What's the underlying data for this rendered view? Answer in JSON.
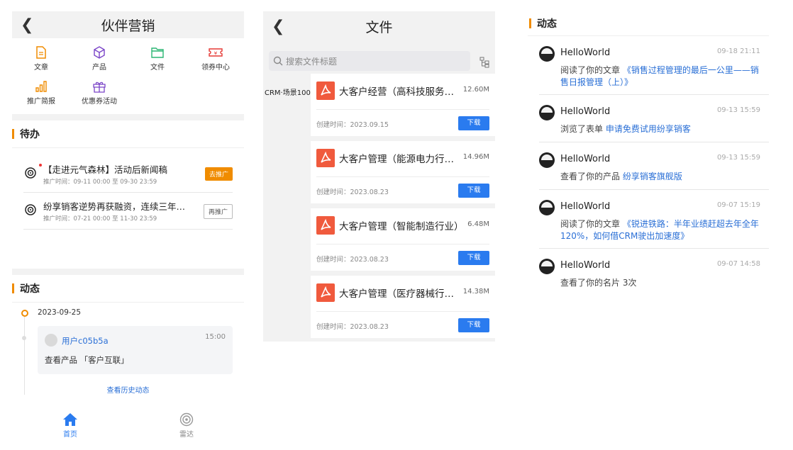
{
  "colors": {
    "accent": "#f08c00",
    "link": "#2a6fd6",
    "primary_button": "#2a7bef",
    "pdf": "#f05a3d"
  },
  "panel1": {
    "title": "伙伴营销",
    "grid": [
      {
        "label": "文章",
        "icon": "document-icon",
        "color": "#f08c00"
      },
      {
        "label": "产品",
        "icon": "cube-icon",
        "color": "#7a44c8"
      },
      {
        "label": "文件",
        "icon": "folder-icon",
        "color": "#2bb673"
      },
      {
        "label": "领券中心",
        "icon": "coupon-icon",
        "color": "#e53935"
      },
      {
        "label": "推广简报",
        "icon": "bar-chart-icon",
        "color": "#f08c00"
      },
      {
        "label": "优惠券活动",
        "icon": "gift-icon",
        "color": "#7a44c8"
      }
    ],
    "todo_title": "待办",
    "todos": [
      {
        "title": "【走进元气森林】活动后新闻稿",
        "time": "推广时间：09-11 00:00 至 09-30 23:59",
        "button": "去推广"
      },
      {
        "title": "纷享销客逆势再获融资，连续三年…",
        "time": "推广时间：07-21 00:00 至 11-30 23:59",
        "button": "再推广"
      }
    ],
    "dyn_title": "动态",
    "timeline_date": "2023-09-25",
    "card_user": "用户c05b5a",
    "card_time": "15:00",
    "card_action": "查看产品 「客户互联」",
    "history_link": "查看历史动态",
    "tabs": [
      {
        "label": "首页",
        "icon": "home-icon"
      },
      {
        "label": "雷达",
        "icon": "radar-icon"
      }
    ]
  },
  "panel2": {
    "title": "文件",
    "search_placeholder": "搜索文件标题",
    "category": "CRM·场景100",
    "files": [
      {
        "name": "大客户经营（高科技服务…",
        "size": "12.60M",
        "created": "创建时间：2023.09.15",
        "download": "下载"
      },
      {
        "name": "大客户管理（能源电力行…",
        "size": "14.96M",
        "created": "创建时间：2023.08.23",
        "download": "下载"
      },
      {
        "name": "大客户管理（智能制造行业）",
        "size": "6.48M",
        "created": "创建时间：2023.08.23",
        "download": "下载"
      },
      {
        "name": "大客户管理（医疗器械行…",
        "size": "14.38M",
        "created": "创建时间：2023.08.23",
        "download": "下载"
      }
    ]
  },
  "panel3": {
    "title": "动态",
    "feed": [
      {
        "name": "HelloWorld",
        "time": "09-18 21:11",
        "action": "阅读了你的文章 ",
        "link": "《销售过程管理的最后一公里——销售日报管理（上）》"
      },
      {
        "name": "HelloWorld",
        "time": "09-13 15:59",
        "action": "浏览了表单 ",
        "link": "申请免费试用纷享销客"
      },
      {
        "name": "HelloWorld",
        "time": "09-13 15:59",
        "action": "查看了你的产品 ",
        "link": "纷享销客旗舰版"
      },
      {
        "name": "HelloWorld",
        "time": "09-07 15:19",
        "action": "阅读了你的文章 ",
        "link": "《锐进铁路：半年业绩赶超去年全年120%，如何借CRM驶出加速度》"
      },
      {
        "name": "HelloWorld",
        "time": "09-07 14:58",
        "action": "查看了你的名片 3次",
        "link": ""
      }
    ]
  }
}
